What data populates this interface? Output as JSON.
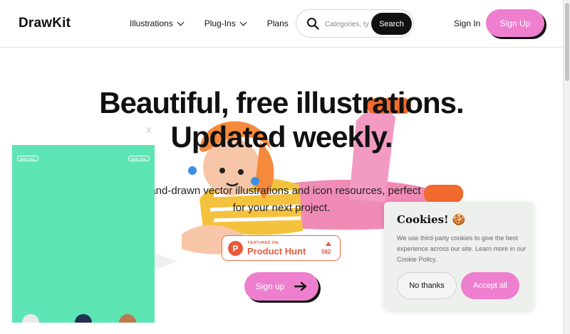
{
  "header": {
    "logo": "DrawKit",
    "nav": [
      {
        "label": "Illustrations",
        "has_dropdown": true
      },
      {
        "label": "Plug-Ins",
        "has_dropdown": true
      },
      {
        "label": "Plans",
        "has_dropdown": false
      }
    ],
    "search": {
      "placeholder": "Categories, ty",
      "button_label": "Search"
    },
    "sign_in_label": "Sign In",
    "sign_up_label": "Sign Up"
  },
  "hero": {
    "title_line1": "Beautiful, free illustrations.",
    "title_line2": "Updated weekly.",
    "subtitle_line1": "Hand-drawn vector illustrations and icon resources, perfect",
    "subtitle_line2": "for your next project.",
    "product_hunt": {
      "featured_label": "FEATURED ON",
      "name": "Product Hunt",
      "count": "582"
    },
    "signup_label": "Sign up"
  },
  "ad": {
    "close_label": "X",
    "tag_left": "NEW TOOL",
    "tag_right": "NEW TOOL"
  },
  "cookie": {
    "title": "Cookies! 🍪",
    "text": "We use third-party cookies to give the best experience across our site. Learn more in our Cookie Policy.",
    "decline_label": "No thanks",
    "accept_label": "Accept all"
  },
  "colors": {
    "accent_pink": "#ee7fcf",
    "ad_green": "#5de5b3",
    "product_hunt": "#e8593a",
    "text_dark": "#111111"
  }
}
